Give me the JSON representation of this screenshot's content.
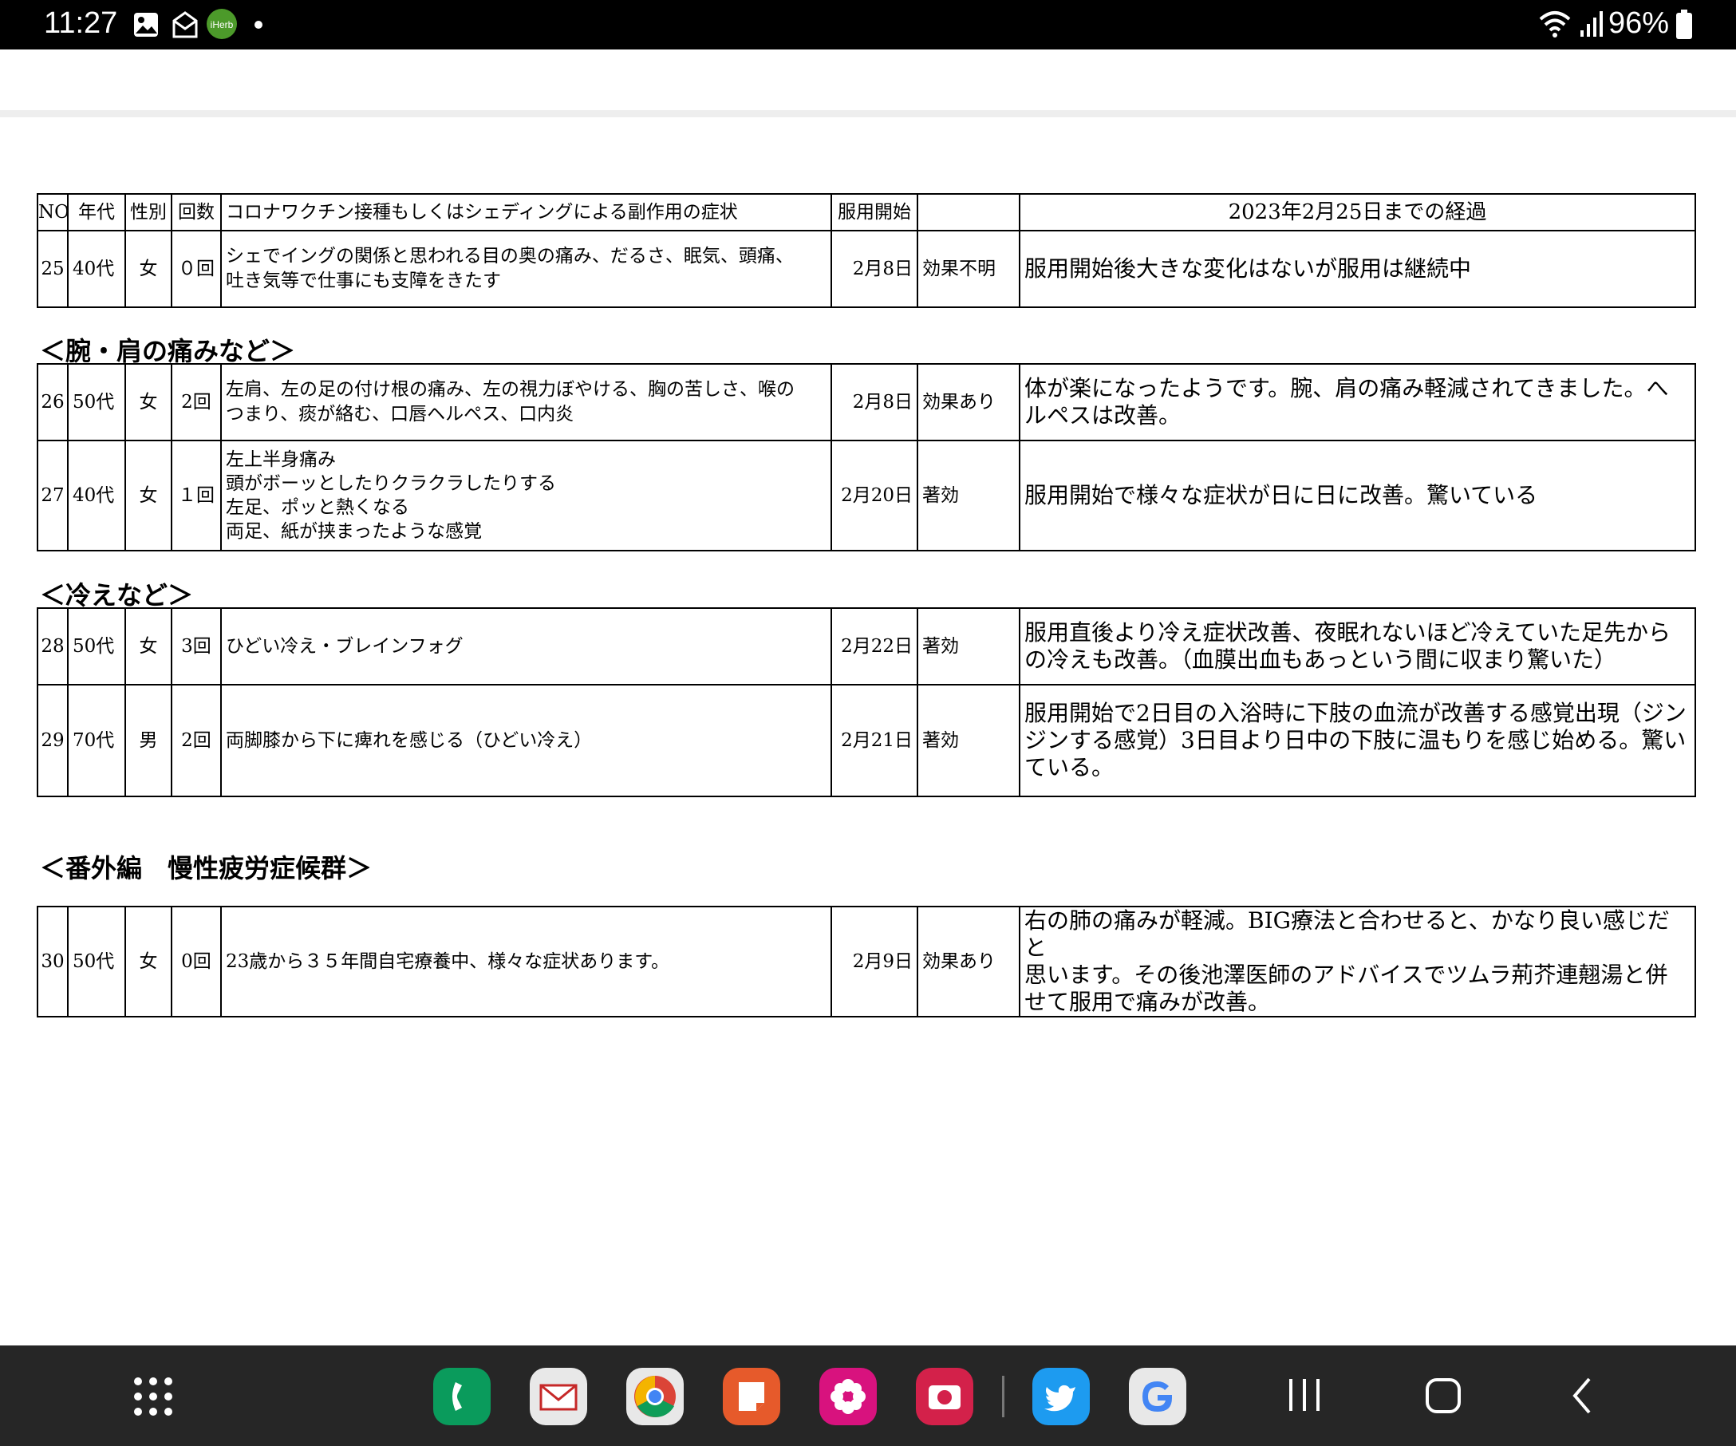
{
  "status_bar": {
    "time": "11:27",
    "battery": "96%",
    "icons": [
      "gallery-icon",
      "mail-notification-icon",
      "iherb-icon",
      "dot-icon",
      "wifi-icon",
      "signal-icon",
      "battery-icon"
    ],
    "iherb_label": "iHerb"
  },
  "table": {
    "headers": {
      "no": "NO",
      "age": "年代",
      "sex": "性別",
      "count": "回数",
      "symptom": "コロナワクチン接種もしくはシェディングによる副作用の症状",
      "start": "服用開始",
      "effect": "",
      "course": "2023年2月25日までの経過"
    },
    "sections": [
      {
        "title": "",
        "rows": [
          {
            "no": "25",
            "age": "40代",
            "sex": "女",
            "count": "０回",
            "symptom": [
              "シェでイングの関係と思われる目の奥の痛み、だるさ、眠気、頭痛、",
              "吐き気等で仕事にも支障をきたす"
            ],
            "start": "2月8日",
            "effect": "効果不明",
            "course": [
              "服用開始後大きな変化はないが服用は継続中"
            ]
          }
        ]
      },
      {
        "title": "＜腕・肩の痛みなど＞",
        "rows": [
          {
            "no": "26",
            "age": "50代",
            "sex": "女",
            "count": "2回",
            "symptom": [
              "左肩、左の足の付け根の痛み、左の視力ぼやける、胸の苦しさ、喉の",
              "つまり、痰が絡む、口唇ヘルペス、口内炎"
            ],
            "start": "2月8日",
            "effect": "効果あり",
            "course": [
              "体が楽になったようです。腕、肩の痛み軽減されてきました。へ",
              "ルペスは改善。"
            ]
          },
          {
            "no": "27",
            "age": "40代",
            "sex": "女",
            "count": "１回",
            "symptom": [
              "左上半身痛み",
              "頭がボーッとしたりクラクラしたりする",
              "左足、ポッと熱くなる",
              "両足、紙が挟まったような感覚"
            ],
            "start": "2月20日",
            "effect": "著効",
            "course": [
              "服用開始で様々な症状が日に日に改善。驚いている"
            ]
          }
        ]
      },
      {
        "title": "＜冷えなど＞",
        "rows": [
          {
            "no": "28",
            "age": "50代",
            "sex": "女",
            "count": "3回",
            "symptom": [
              "ひどい冷え・ブレインフォグ"
            ],
            "start": "2月22日",
            "effect": "著効",
            "course": [
              "服用直後より冷え症状改善、夜眠れないほど冷えていた足先から",
              "の冷えも改善。（血膜出血もあっという間に収まり驚いた）"
            ]
          },
          {
            "no": "29",
            "age": "70代",
            "sex": "男",
            "count": "2回",
            "symptom": [
              "両脚膝から下に痺れを感じる（ひどい冷え）"
            ],
            "start": "2月21日",
            "effect": "著効",
            "course": [
              "服用開始で2日目の入浴時に下肢の血流が改善する感覚出現（ジン",
              "ジンする感覚）3日目より日中の下肢に温もりを感じ始める。驚い",
              "ている。"
            ]
          }
        ]
      },
      {
        "title": "＜番外編　慢性疲労症候群＞",
        "rows": [
          {
            "no": "30",
            "age": "50代",
            "sex": "女",
            "count": "0回",
            "symptom": [
              "23歳から３５年間自宅療養中、様々な症状あります。"
            ],
            "start": "2月9日",
            "effect": "効果あり",
            "course": [
              "右の肺の痛みが軽減。BIG療法と合わせると、かなり良い感じだと",
              "思います。その後池澤医師のアドバイスでツムラ荊芥連翹湯と併",
              "せて服用で痛みが改善。"
            ]
          }
        ]
      }
    ]
  },
  "nav_bar": {
    "apps": [
      "app-drawer-icon",
      "phone-icon",
      "mail-icon",
      "chrome-icon",
      "notes-icon",
      "flower-icon",
      "camera-icon",
      "twitter-icon",
      "google-icon"
    ],
    "buttons": [
      "recents-button",
      "home-button",
      "back-button"
    ]
  }
}
